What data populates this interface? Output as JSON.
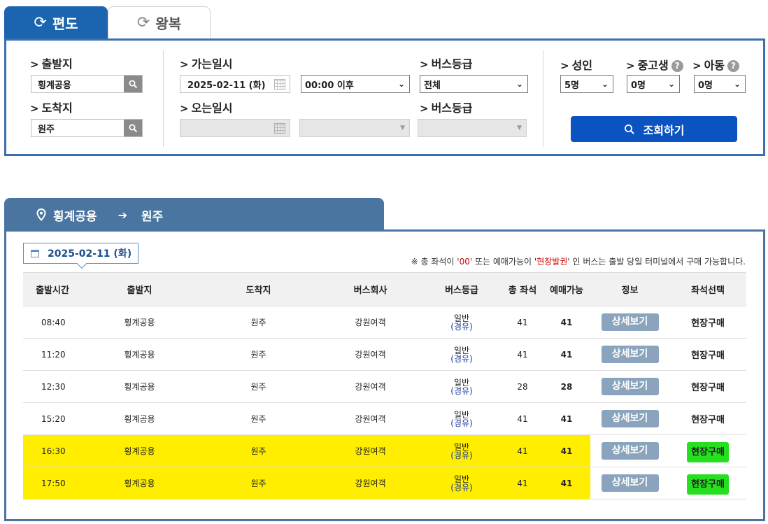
{
  "tabs": {
    "oneway_label": "편도",
    "round_label": "왕복"
  },
  "search": {
    "depart_label": "출발지",
    "depart_value": "횡계공용",
    "arrive_label": "도착지",
    "arrive_value": "원주",
    "go_date_label": "가는일시",
    "go_date_value": "2025-02-11 (화)",
    "go_time_value": "00:00 이후",
    "return_date_label": "오는일시",
    "bus_grade_label": "버스등급",
    "bus_grade_value": "전체",
    "bus_grade_label2": "버스등급",
    "adult_label": "성인",
    "adult_value": "5명",
    "student_label": "중고생",
    "student_value": "0명",
    "child_label": "아동",
    "child_value": "0명",
    "search_button": "조회하기",
    "help_mark": "?"
  },
  "results": {
    "from": "횡계공용",
    "to": "원주",
    "date": "2025-02-11 (화)",
    "notice_pre": "※ 총 좌석이 '",
    "notice_zero": "00",
    "notice_mid": "' 또는 예매가능이 '",
    "notice_onsite": "현장발권",
    "notice_post": "' 인 버스는 출발 당일 터미널에서 구매 가능합니다.",
    "headers": [
      "출발시간",
      "출발지",
      "도착지",
      "버스회사",
      "버스등급",
      "총 좌석",
      "예매가능",
      "정보",
      "좌석선택"
    ],
    "rows": [
      {
        "time": "08:40",
        "from": "횡계공용",
        "to": "원주",
        "company": "강원여객",
        "grade": "일반",
        "grade_sub": "(경유)",
        "total": "41",
        "avail": "41",
        "info": "상세보기",
        "select": "현장구매"
      },
      {
        "time": "11:20",
        "from": "횡계공용",
        "to": "원주",
        "company": "강원여객",
        "grade": "일반",
        "grade_sub": "(경유)",
        "total": "41",
        "avail": "41",
        "info": "상세보기",
        "select": "현장구매"
      },
      {
        "time": "12:30",
        "from": "횡계공용",
        "to": "원주",
        "company": "강원여객",
        "grade": "일반",
        "grade_sub": "(경유)",
        "total": "28",
        "avail": "28",
        "info": "상세보기",
        "select": "현장구매"
      },
      {
        "time": "15:20",
        "from": "횡계공용",
        "to": "원주",
        "company": "강원여객",
        "grade": "일반",
        "grade_sub": "(경유)",
        "total": "41",
        "avail": "41",
        "info": "상세보기",
        "select": "현장구매"
      },
      {
        "time": "16:30",
        "from": "횡계공용",
        "to": "원주",
        "company": "강원여객",
        "grade": "일반",
        "grade_sub": "(경유)",
        "total": "41",
        "avail": "41",
        "info": "상세보기",
        "select": "현장구매"
      },
      {
        "time": "17:50",
        "from": "횡계공용",
        "to": "원주",
        "company": "강원여객",
        "grade": "일반",
        "grade_sub": "(경유)",
        "total": "41",
        "avail": "41",
        "info": "상세보기",
        "select": "현장구매"
      }
    ]
  },
  "colors": {
    "primary": "#1a64b0",
    "route_bar": "#4a75a0",
    "highlight_yellow": "#ffee00",
    "highlight_green": "#26e020"
  }
}
